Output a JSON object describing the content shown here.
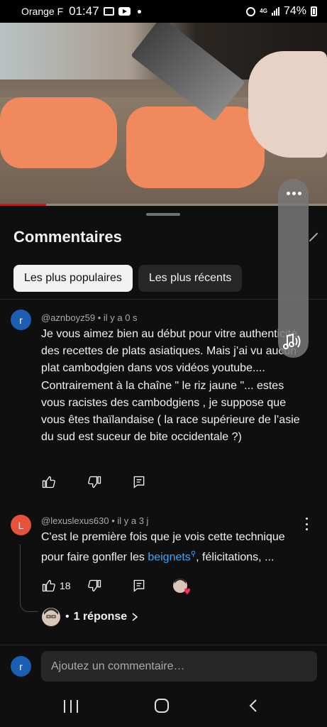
{
  "status_bar": {
    "carrier": "Orange F",
    "time": "01:47",
    "network": "4G",
    "battery": "74%"
  },
  "video": {
    "progress_fraction": 0.14
  },
  "comments_panel": {
    "title": "Commentaires",
    "chips": [
      {
        "label": "Les plus populaires",
        "active": true
      },
      {
        "label": "Les plus récents",
        "active": false
      }
    ],
    "comments": [
      {
        "avatar_letter": "r",
        "author_meta": "@aznboyz59 • il y a 0 s",
        "text": "Je vous aimez bien au début pour vitre authenticité  des recettes de plats asiatiques. Mais j’ai vu aucun plat cambodgien dans vos vidéos youtube.... Contrairement  à la chaîne \" le riz jaune \"... estes vous racistes des cambodgiens , je suppose que vous êtes thaïlandaise ( la race supérieure  de l’asie du sud est suceur de bite occidentale ?)"
      },
      {
        "avatar_letter": "L",
        "author_meta": "@lexuslexus630 • il y a 3 j",
        "text_before_link": "C'est le première fois que je vois cette technique pour faire gonfler les ",
        "link_text": "beignets",
        "text_after_link": ", félicitations, ...",
        "like_count": "18",
        "replies_label": "1 réponse"
      }
    ]
  },
  "composer": {
    "avatar_letter": "r",
    "placeholder": "Ajoutez un commentaire…"
  },
  "colors": {
    "background": "#0f0f0f",
    "chip_active": "#f1f1f1",
    "chip_inactive": "#272727",
    "link": "#3ea6ff",
    "avatar_blue": "#1a5fb4",
    "avatar_orange": "#e8513a"
  },
  "icons": [
    "image-icon",
    "youtube-icon",
    "alarm-icon",
    "signal-icon",
    "battery-icon",
    "close-icon",
    "like-icon",
    "dislike-icon",
    "reply-icon",
    "more-vert-icon",
    "music-icon",
    "chevron-right-icon"
  ]
}
